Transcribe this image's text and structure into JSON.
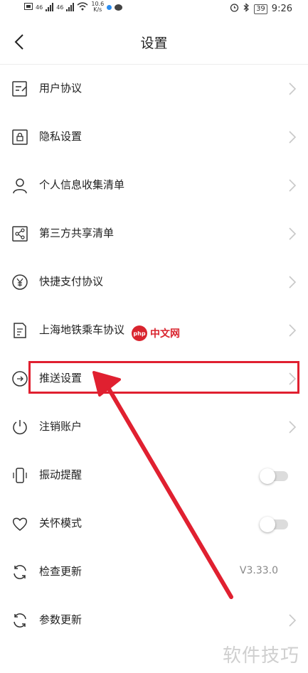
{
  "status_bar": {
    "left_tags": [
      "46",
      "46"
    ],
    "net_speed_value": "10.6",
    "net_speed_unit": "K/s",
    "battery": "39",
    "time": "9:26"
  },
  "header": {
    "title": "设置"
  },
  "menu": {
    "items": [
      {
        "label": "用户协议"
      },
      {
        "label": "隐私设置"
      },
      {
        "label": "个人信息收集清单"
      },
      {
        "label": "第三方共享清单"
      },
      {
        "label": "快捷支付协议"
      },
      {
        "label": "上海地铁乘车协议"
      },
      {
        "label": "推送设置"
      },
      {
        "label": "注销账户"
      },
      {
        "label": "振动提醒",
        "toggle_on": false
      },
      {
        "label": "关怀模式",
        "toggle_on": false
      },
      {
        "label": "检查更新",
        "value": "V3.33.0"
      },
      {
        "label": "参数更新"
      }
    ]
  },
  "watermarks": {
    "php_badge": "php",
    "php_text": "中文网",
    "corner": "软件技巧"
  },
  "colors": {
    "highlight": "#e02030",
    "text": "#222222",
    "chevron": "#c8c8c8"
  }
}
